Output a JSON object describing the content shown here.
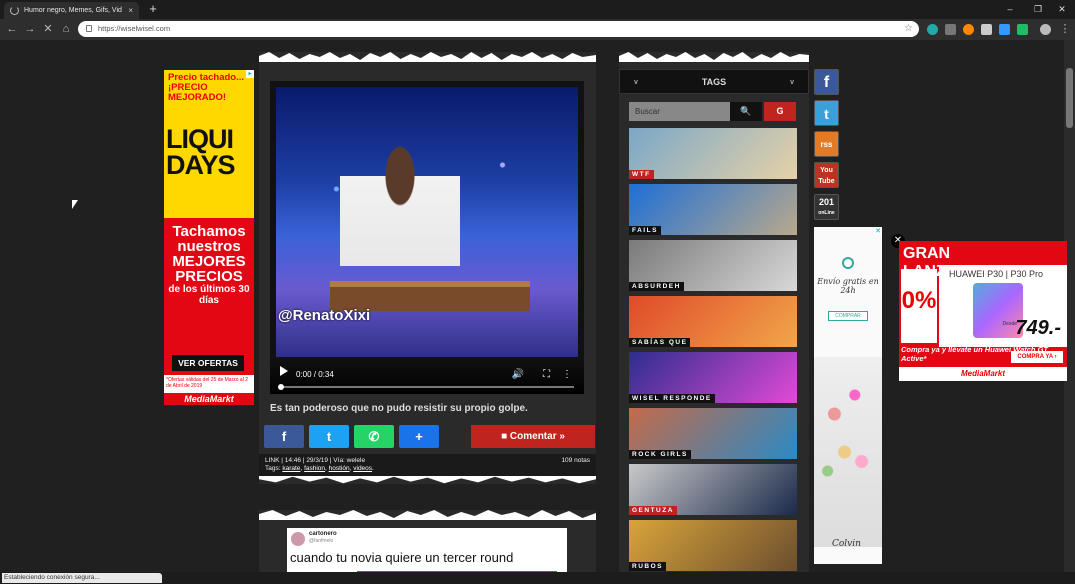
{
  "browser": {
    "tab_title": "Humor negro, Memes, Gifs, Vid",
    "tab_close": "×",
    "new_tab": "+",
    "url": "https://wiselwisel.com",
    "window_controls": [
      "–",
      "❐",
      "✕"
    ],
    "status_text": "Estableciendo conexión segura..."
  },
  "left_ad": {
    "top": "Precio tachado... ¡PRECIO MEJORADO!",
    "brand_big": "LIQUI DAYS",
    "headline": "Tachamos nuestros MEJORES PRECIOS",
    "sub": "de los últimos 30 días",
    "cta": "VER OFERTAS",
    "disclaimer": "*Ofertas válidas del 25 de Marzo al 2 de Abril de 2019",
    "logo": "MediaMarkt"
  },
  "post": {
    "video_watermark": "@RenatoXixi",
    "video_time": "0:00 / 0:34",
    "caption": "Es tan poderoso que no pudo resistir su propio golpe.",
    "comment_label": "Comentar  »",
    "meta_line1": "LINK | 14:46 | 29/3/19 | Vía: welele",
    "tags_label": "Tags:",
    "tags": [
      "karate",
      "fashion",
      "hostión",
      "videos"
    ],
    "notes": "109 notas"
  },
  "post2": {
    "user": "cartonero",
    "handle": "@fanfmelo",
    "text": "cuando tu novia quiere un tercer round"
  },
  "sidebar": {
    "tags_title": "TAGS",
    "chevron": "v",
    "search_placeholder": "Buscar",
    "search_g": "G",
    "tag_cards": [
      {
        "label": "WTF",
        "colors": [
          "#7aa7c7",
          "#e6d2a8"
        ]
      },
      {
        "label": "FAILS",
        "colors": [
          "#1e6fd6",
          "#b9a98c"
        ]
      },
      {
        "label": "ABSURDEH",
        "colors": [
          "#7a7a7a",
          "#d8d8d8"
        ]
      },
      {
        "label": "SABÍAS QUE",
        "colors": [
          "#e04a2a",
          "#f1a64a"
        ]
      },
      {
        "label": "WISEL RESPONDE",
        "colors": [
          "#2d2d8f",
          "#e24ad6"
        ]
      },
      {
        "label": "ROCK GIRLS",
        "colors": [
          "#c46a4a",
          "#2a8ac6"
        ]
      },
      {
        "label": "GENTUZA",
        "colors": [
          "#c9c9c9",
          "#1b2a4a"
        ]
      },
      {
        "label": "RUBOS",
        "colors": [
          "#d9a43a",
          "#6b4e2e"
        ]
      }
    ]
  },
  "social": {
    "facebook": "f",
    "twitter": "t",
    "rss": "rss",
    "youtube": "You Tube",
    "count": "201",
    "count_label": "onLine"
  },
  "mid_ad": {
    "text": "Envío gratis en 24h",
    "cta": "COMPRAR",
    "signature": "Colvin",
    "close": "✕"
  },
  "right_ad": {
    "title": "GRAN LANZAMIENTO",
    "model": "HUAWEI P30 | P30 Pro",
    "badge": "0%",
    "desde": "Desde",
    "price": "749.-",
    "bottom": "Compra ya y llévate un Huawei Watch GT Active*",
    "cta": "COMPRA YA ›",
    "logo": "MediaMarkt",
    "close": "✕"
  }
}
